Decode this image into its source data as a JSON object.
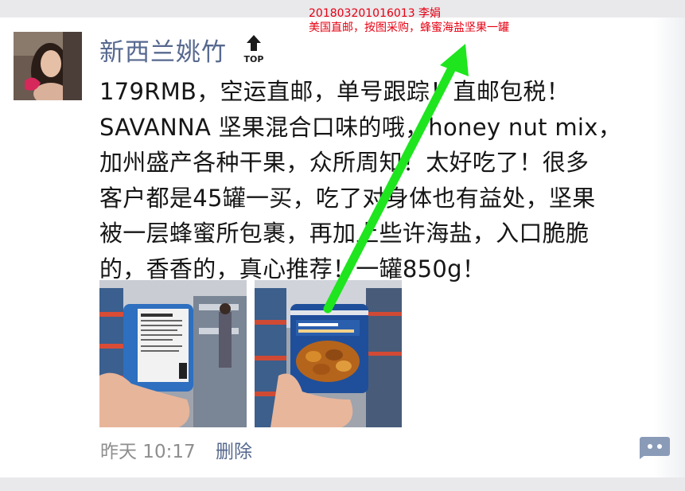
{
  "post": {
    "username": "新西兰姚竹",
    "top_label": "TOP",
    "text": "179RMB，空运直邮，单号跟踪！直邮包税！\nSAVANNA 坚果混合口味的哦，honey nut mix，\n加州盛产各种干果，众所周知！太好吃了！很多\n客户都是45罐一买，吃了对身体也有益处，坚果\n被一层蜂蜜所包裹，再加上些许海盐，入口脆脆\n的，香香的，真心推荐！一罐850g！",
    "time": "昨天 10:17",
    "delete_label": "删除"
  },
  "annotation": {
    "line1": "201803201016013   李娟",
    "line2": "美国直邮，按图采购，蜂蜜海盐坚果一罐"
  },
  "colors": {
    "link": "#57698f",
    "annotation": "#e60012",
    "arrow": "#1ee51e"
  },
  "icons": [
    "pin-top-icon",
    "comment-icon"
  ]
}
